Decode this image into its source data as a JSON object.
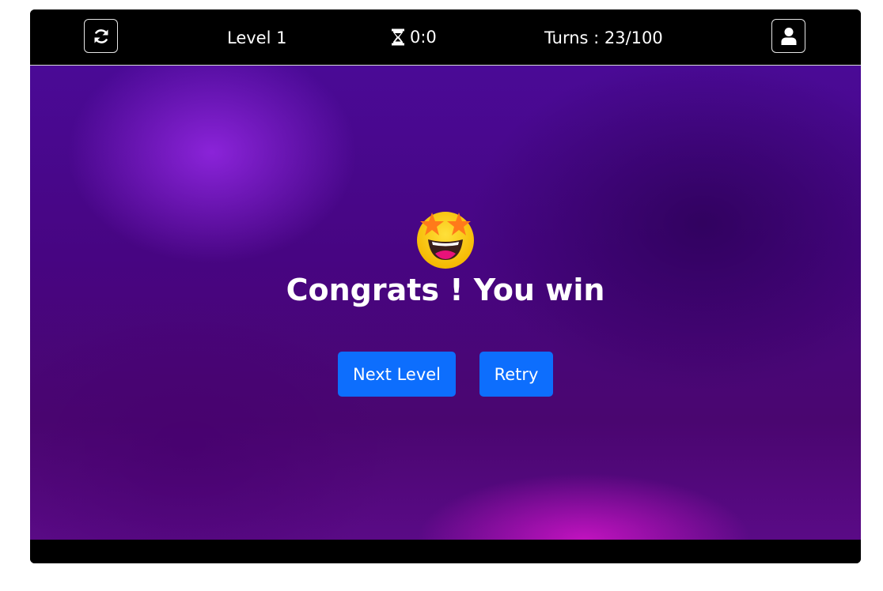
{
  "header": {
    "level_label": "Level 1",
    "timer_value": "0:0",
    "turns_label": "Turns : 23/100",
    "refresh_icon": "refresh-icon",
    "profile_icon": "user-icon",
    "timer_icon": "hourglass-icon"
  },
  "result": {
    "emoji": "star-struck-emoji",
    "title": "Congrats ! You win",
    "next_button": "Next Level",
    "retry_button": "Retry"
  },
  "colors": {
    "button": "#0d6efd",
    "background": "#4a0a96",
    "bar": "#000000"
  }
}
